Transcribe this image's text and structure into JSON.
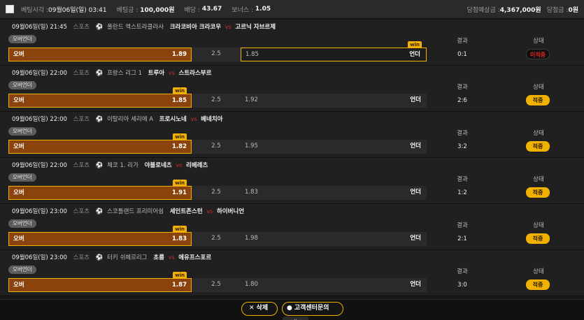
{
  "topbar": {
    "bet_time_label": "베팅시각 :",
    "bet_time": "09월06일(일) 03:41",
    "bet_amount_label": "베팅금 :",
    "bet_amount": "100,000원",
    "odds_label": "배당 :",
    "odds": "43.67",
    "bonus_label": "보너스 :",
    "bonus": "1.05",
    "expected_label": "당첨예상금 :",
    "expected": "4,367,000원",
    "won_label": "당첨금 :",
    "won": "0원"
  },
  "common": {
    "sport": "스포츠",
    "vs": "vs",
    "market": "오버언더",
    "result_label": "결과",
    "status_label": "상태",
    "over": "오버",
    "under": "언더",
    "win": "win"
  },
  "matches": [
    {
      "datetime": "09월06일(일) 21:45",
      "league": "폴란드 엑스트라클라사",
      "home": "크라코비아 크라코우",
      "away": "고르닉 자브르제",
      "over_odd": "1.89",
      "line": "2.5",
      "under_odd": "1.85",
      "score": "0:1",
      "status": "미적중",
      "selected": "over",
      "winner": "under"
    },
    {
      "datetime": "09월06일(일) 22:00",
      "league": "프랑스 리그 1",
      "home": "트루아",
      "away": "스트라스부르",
      "over_odd": "1.85",
      "line": "2.5",
      "under_odd": "1.92",
      "score": "2:6",
      "status": "적중",
      "selected": "over",
      "winner": "over"
    },
    {
      "datetime": "09월06일(일) 22:00",
      "league": "이탈리아 세리에 A",
      "home": "프로시노네",
      "away": "베네치아",
      "over_odd": "1.82",
      "line": "2.5",
      "under_odd": "1.95",
      "score": "3:2",
      "status": "적중",
      "selected": "over",
      "winner": "over"
    },
    {
      "datetime": "09월06일(일) 22:00",
      "league": "체코 1. 리가",
      "home": "야블로네츠",
      "away": "리베레츠",
      "over_odd": "1.91",
      "line": "2.5",
      "under_odd": "1.83",
      "score": "1:2",
      "status": "적중",
      "selected": "over",
      "winner": "over"
    },
    {
      "datetime": "09월06일(일) 23:00",
      "league": "스코틀랜드 프리미어쉽",
      "home": "세인트존스턴",
      "away": "하이버니언",
      "over_odd": "1.83",
      "line": "2.5",
      "under_odd": "1.98",
      "score": "2:1",
      "status": "적중",
      "selected": "over",
      "winner": "over"
    },
    {
      "datetime": "09월06일(일) 23:00",
      "league": "터키 쉬페르리그",
      "home": "초룸",
      "away": "에유프스포르",
      "over_odd": "1.87",
      "line": "2.5",
      "under_odd": "1.80",
      "score": "3:0",
      "status": "적중",
      "selected": "over",
      "winner": "over"
    }
  ],
  "buttons": {
    "delete": "삭제",
    "delete_icon": "close-icon",
    "customer_center": "고객센터문의",
    "customer_icon": "person-icon"
  },
  "colors": {
    "accent": "#f0b100",
    "selected_bg": "#8a430d",
    "miss": "#e02424"
  }
}
